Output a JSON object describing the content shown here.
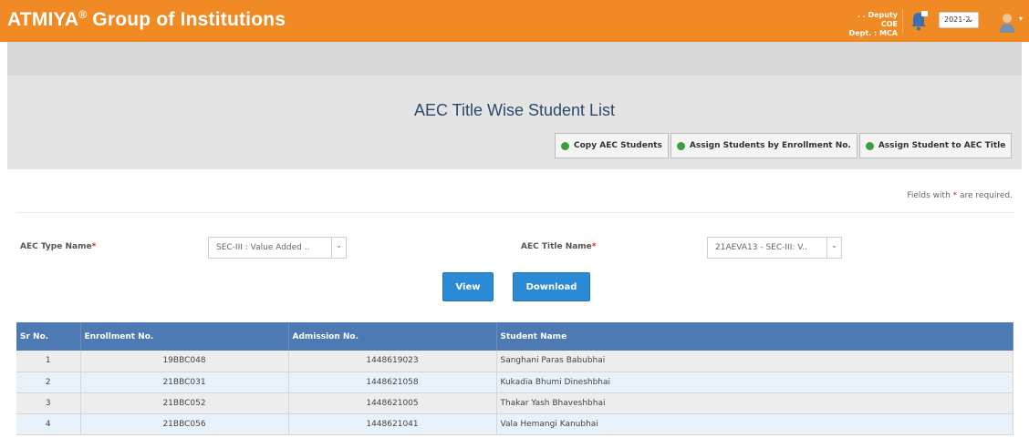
{
  "header": {
    "brand_name": "ATMIYA",
    "brand_mark": "®",
    "brand_rest": " Group of Institutions",
    "user_role": ". . Deputy COE",
    "user_dept": "Dept. : MCA",
    "year_value": "2021-2",
    "bell_icon": "bell-icon",
    "user_icon": "user-icon",
    "color_bar": "#f08a24"
  },
  "page": {
    "title": "AEC Title Wise Student List",
    "actions": [
      {
        "label": "Copy AEC Students",
        "icon": "green-dot-icon"
      },
      {
        "label": "Assign Students by Enrollment No.",
        "icon": "green-dot-icon"
      },
      {
        "label": "Assign Student to AEC Title",
        "icon": "green-dot-icon"
      }
    ],
    "required_note_prefix": "Fields with ",
    "required_note_star": "*",
    "required_note_suffix": " are required."
  },
  "form": {
    "aec_type_label": "AEC Type Name",
    "aec_type_value": "SEC-III : Value Added ..",
    "aec_title_label": "AEC Title Name",
    "aec_title_value": "21AEVA13 - SEC-III: V..",
    "required_star": "*",
    "view_label": "View",
    "download_label": "Download"
  },
  "table": {
    "columns": [
      "Sr No.",
      "Enrollment No.",
      "Admission No.",
      "Student Name"
    ],
    "rows": [
      {
        "sr": "1",
        "enrollment": "19BBC048",
        "admission": "1448619023",
        "name": "Sanghani Paras Babubhai"
      },
      {
        "sr": "2",
        "enrollment": "21BBC031",
        "admission": "1448621058",
        "name": "Kukadia Bhumi Dineshbhai"
      },
      {
        "sr": "3",
        "enrollment": "21BBC052",
        "admission": "1448621005",
        "name": "Thakar Yash Bhaveshbhai"
      },
      {
        "sr": "4",
        "enrollment": "21BBC056",
        "admission": "1448621041",
        "name": "Vala Hemangi Kanubhai"
      }
    ]
  },
  "colors": {
    "header_orange": "#f08a24",
    "primary_blue": "#2a8ad6",
    "table_header": "#4d7ab3",
    "title_text": "#2c4a6b"
  }
}
